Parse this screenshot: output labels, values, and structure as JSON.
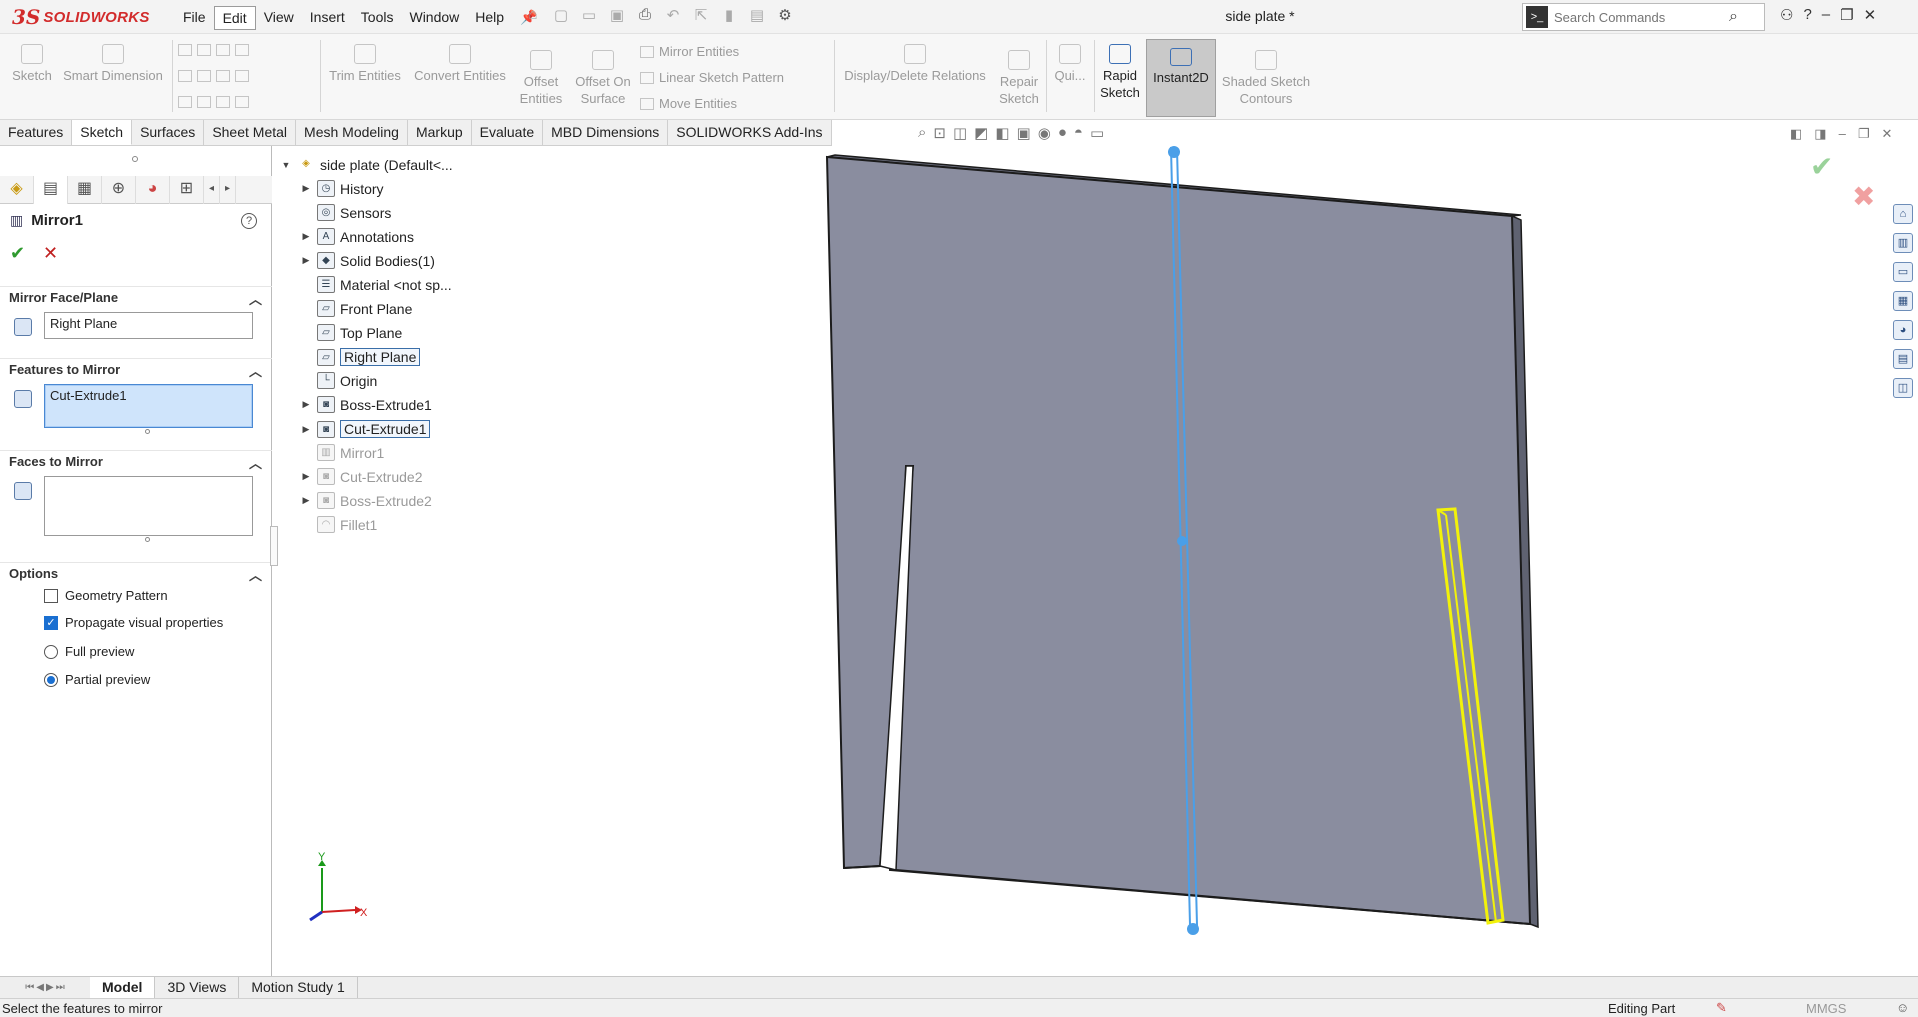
{
  "app": {
    "logo_mark": "3S",
    "logo_text": "SOLIDWORKS",
    "document_title": "side plate *"
  },
  "menu": [
    "File",
    "Edit",
    "View",
    "Insert",
    "Tools",
    "Window",
    "Help"
  ],
  "active_menu": "Edit",
  "search": {
    "placeholder": "Search Commands"
  },
  "command_manager": {
    "sketch": "Sketch",
    "smart_dimension": "Smart Dimension",
    "trim_entities": "Trim Entities",
    "convert_entities": "Convert Entities",
    "offset_entities": [
      "Offset",
      "Entities"
    ],
    "offset_on_surface": [
      "Offset On",
      "Surface"
    ],
    "mirror_entities": "Mirror Entities",
    "linear_sketch_pattern": "Linear Sketch Pattern",
    "move_entities": "Move Entities",
    "display_delete_relations": "Display/Delete Relations",
    "repair_sketch": [
      "Repair",
      "Sketch"
    ],
    "quick_snaps": "Qui...",
    "rapid_sketch": [
      "Rapid",
      "Sketch"
    ],
    "instant2d": "Instant2D",
    "shaded_sketch_contours": [
      "Shaded Sketch",
      "Contours"
    ]
  },
  "tabs": [
    "Features",
    "Sketch",
    "Surfaces",
    "Sheet Metal",
    "Mesh Modeling",
    "Markup",
    "Evaluate",
    "MBD Dimensions",
    "SOLIDWORKS Add-Ins"
  ],
  "active_tab": "Sketch",
  "property_manager": {
    "title": "Mirror1",
    "help": "?",
    "ok": "✔",
    "cancel": "✕",
    "mirror_face_plane": {
      "header": "Mirror Face/Plane",
      "value": "Right Plane"
    },
    "features_to_mirror": {
      "header": "Features to Mirror",
      "value": "Cut-Extrude1"
    },
    "faces_to_mirror": {
      "header": "Faces to Mirror",
      "value": ""
    },
    "options": {
      "header": "Options",
      "geometry_pattern": {
        "label": "Geometry Pattern",
        "checked": false
      },
      "propagate_visual": {
        "label": "Propagate visual properties",
        "checked": true
      },
      "full_preview": {
        "label": "Full preview",
        "selected": false
      },
      "partial_preview": {
        "label": "Partial preview",
        "selected": true
      }
    }
  },
  "feature_tree": [
    {
      "label": "side plate  (Default<...",
      "expandable": "open",
      "state": "normal"
    },
    {
      "label": "History",
      "expandable": "closed",
      "state": "normal"
    },
    {
      "label": "Sensors",
      "expandable": "none",
      "state": "normal"
    },
    {
      "label": "Annotations",
      "expandable": "closed",
      "state": "normal"
    },
    {
      "label": "Solid Bodies(1)",
      "expandable": "closed",
      "state": "normal"
    },
    {
      "label": "Material <not sp...",
      "expandable": "none",
      "state": "normal"
    },
    {
      "label": "Front Plane",
      "expandable": "none",
      "state": "normal"
    },
    {
      "label": "Top Plane",
      "expandable": "none",
      "state": "normal"
    },
    {
      "label": "Right Plane",
      "expandable": "none",
      "state": "boxed"
    },
    {
      "label": "Origin",
      "expandable": "none",
      "state": "normal"
    },
    {
      "label": "Boss-Extrude1",
      "expandable": "closed",
      "state": "normal"
    },
    {
      "label": "Cut-Extrude1",
      "expandable": "closed",
      "state": "boxed"
    },
    {
      "label": "Mirror1",
      "expandable": "none",
      "state": "dim"
    },
    {
      "label": "Cut-Extrude2",
      "expandable": "closed",
      "state": "dim"
    },
    {
      "label": "Boss-Extrude2",
      "expandable": "closed",
      "state": "dim"
    },
    {
      "label": "Fillet1",
      "expandable": "none",
      "state": "dim"
    }
  ],
  "triad": {
    "x": "X",
    "y": "Y"
  },
  "bottom_tabs": [
    "Model",
    "3D Views",
    "Motion Study 1"
  ],
  "active_bottom_tab": "Model",
  "status": {
    "message": "Select the features to mirror",
    "mode": "Editing Part",
    "units": "MMGS"
  },
  "colors": {
    "plate_face": "#8a8d9f",
    "plate_edge": "#1c1c1c",
    "plane_line": "#4a9fe8",
    "highlight": "#f2f20a"
  }
}
